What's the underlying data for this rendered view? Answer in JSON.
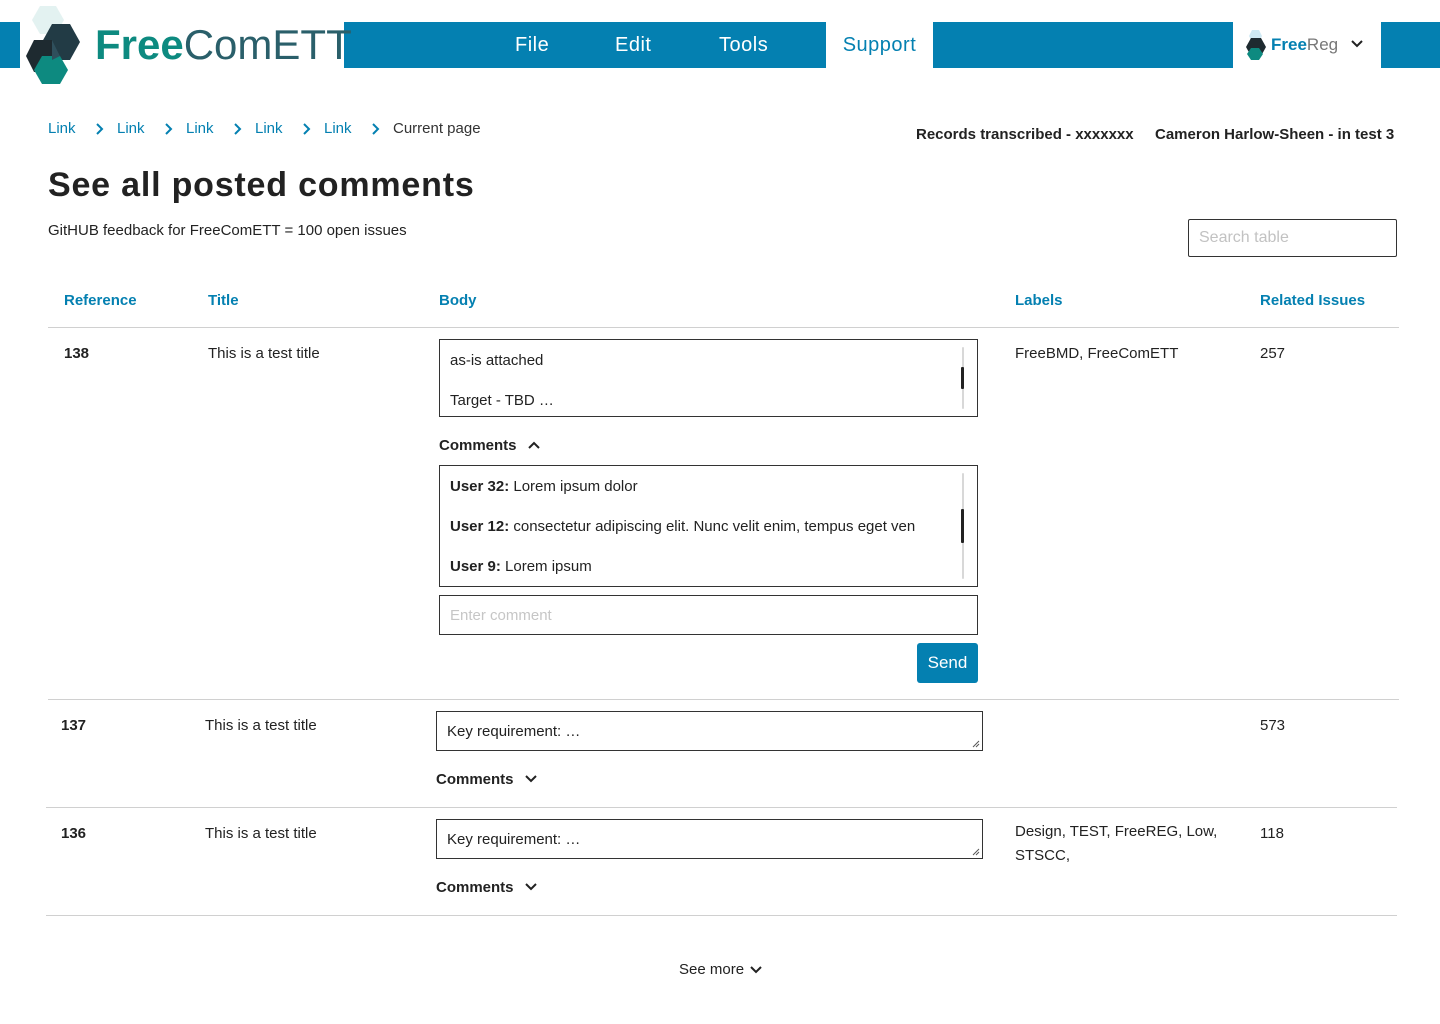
{
  "brand": {
    "logo_free": "Free",
    "logo_comett": "ComETT",
    "accent": "#0480b1",
    "logo_green": "#0d8a80"
  },
  "nav": {
    "file": "File",
    "edit": "Edit",
    "tools": "Tools",
    "support": "Support"
  },
  "switcher": {
    "free": "Free",
    "reg": "Reg",
    "icon": "chevron-down-icon"
  },
  "breadcrumb": {
    "links": [
      "Link",
      "Link",
      "Link",
      "Link",
      "Link"
    ],
    "current": "Current page"
  },
  "header_meta": {
    "records": "Records transcribed - xxxxxxx",
    "user": "Cameron Harlow-Sheen - in  test 3"
  },
  "page": {
    "title": "See all posted comments",
    "subtitle": "GitHUB feedback for FreeComETT = 100 open issues",
    "search_placeholder": "Search table"
  },
  "table": {
    "headers": {
      "reference": "Reference",
      "title": "Title",
      "body": "Body",
      "labels": "Labels",
      "related": "Related Issues"
    },
    "rows": [
      {
        "reference": "138",
        "title": "This is a test title",
        "body_lines": [
          "as-is attached",
          "Target - TBD …"
        ],
        "labels": "FreeBMD, FreeComETT",
        "related": "257",
        "comments_label": "Comments",
        "comments_expanded": true,
        "comments": [
          {
            "user": "User 32:",
            "text": " Lorem ipsum dolor"
          },
          {
            "user": "User 12:",
            "text": " consectetur adipiscing elit. Nunc velit enim, tempus eget ven"
          },
          {
            "user": "User 9:",
            "text": " Lorem ipsum"
          }
        ],
        "comment_placeholder": "Enter comment",
        "send_label": "Send"
      },
      {
        "reference": "137",
        "title": "This is a test title",
        "body_lines": [
          "Key requirement: …"
        ],
        "labels": "",
        "related": "573",
        "comments_label": "Comments",
        "comments_expanded": false
      },
      {
        "reference": "136",
        "title": "This is a test title",
        "body_lines": [
          "Key requirement: …"
        ],
        "labels_line1": "Design, TEST, FreeREG, Low,",
        "labels_line2": "STSCC,",
        "related": "118",
        "comments_label": "Comments",
        "comments_expanded": false
      }
    ]
  },
  "see_more": "See more"
}
